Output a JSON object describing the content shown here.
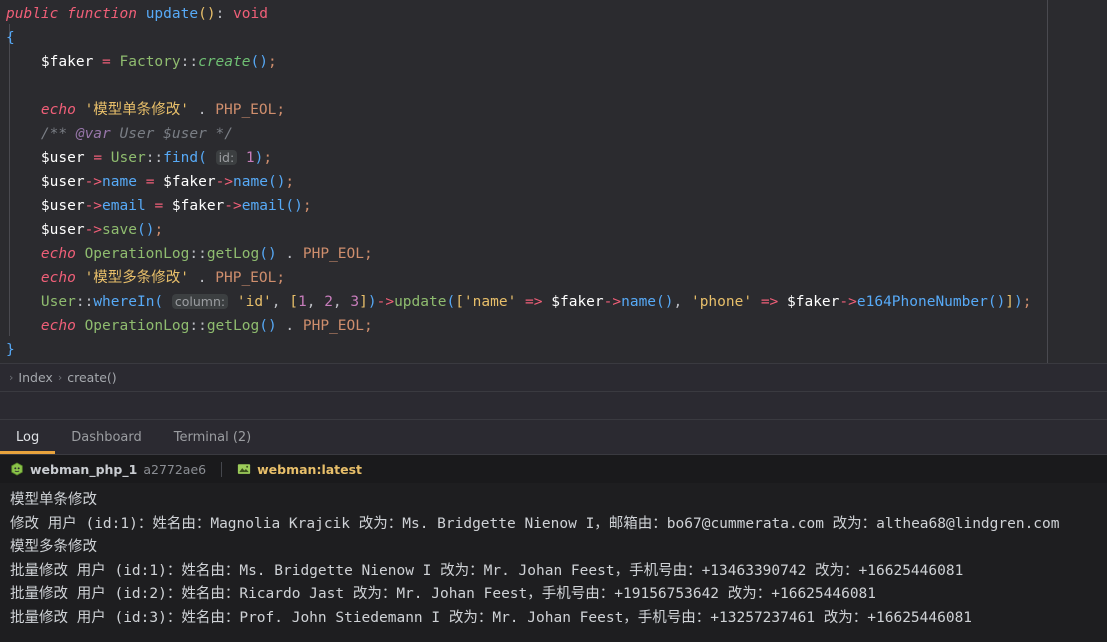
{
  "editor": {
    "name": "php-code-editor",
    "lines": [
      [
        {
          "t": "public",
          "c": "t-kw2"
        },
        {
          "t": " ",
          "c": "t-punct"
        },
        {
          "t": "function",
          "c": "t-kw2"
        },
        {
          "t": " ",
          "c": "t-punct"
        },
        {
          "t": "update",
          "c": "t-method"
        },
        {
          "t": "(",
          "c": "t-paren2"
        },
        {
          "t": ")",
          "c": "t-paren2"
        },
        {
          "t": ":",
          "c": "t-punct"
        },
        {
          "t": " ",
          "c": "t-punct"
        },
        {
          "t": "void",
          "c": "t-void"
        }
      ],
      [
        {
          "t": "{",
          "c": "t-brace"
        }
      ],
      [
        {
          "t": "    ",
          "c": "t-punct"
        },
        {
          "t": "$faker",
          "c": "t-var"
        },
        {
          "t": " ",
          "c": "t-punct"
        },
        {
          "t": "=",
          "c": "t-op"
        },
        {
          "t": " ",
          "c": "t-punct"
        },
        {
          "t": "Factory",
          "c": "t-class"
        },
        {
          "t": "::",
          "c": "t-punct"
        },
        {
          "t": "create",
          "c": "t-methodi"
        },
        {
          "t": "(",
          "c": "t-paren"
        },
        {
          "t": ")",
          "c": "t-paren"
        },
        {
          "t": ";",
          "c": "t-semi"
        }
      ],
      [],
      [
        {
          "t": "    ",
          "c": "t-punct"
        },
        {
          "t": "echo",
          "c": "t-echo"
        },
        {
          "t": " ",
          "c": "t-punct"
        },
        {
          "t": "'模型单条修改'",
          "c": "t-str"
        },
        {
          "t": " ",
          "c": "t-punct"
        },
        {
          "t": ".",
          "c": "t-punct"
        },
        {
          "t": " ",
          "c": "t-punct"
        },
        {
          "t": "PHP_EOL",
          "c": "t-const"
        },
        {
          "t": ";",
          "c": "t-semi"
        }
      ],
      [
        {
          "t": "    ",
          "c": "t-punct"
        },
        {
          "t": "/** ",
          "c": "t-comment"
        },
        {
          "t": "@var",
          "c": "t-tag"
        },
        {
          "t": " User $user */",
          "c": "t-comment"
        }
      ],
      [
        {
          "t": "    ",
          "c": "t-punct"
        },
        {
          "t": "$user",
          "c": "t-var"
        },
        {
          "t": " ",
          "c": "t-punct"
        },
        {
          "t": "=",
          "c": "t-op"
        },
        {
          "t": " ",
          "c": "t-punct"
        },
        {
          "t": "User",
          "c": "t-class"
        },
        {
          "t": "::",
          "c": "t-punct"
        },
        {
          "t": "find",
          "c": "t-method"
        },
        {
          "t": "(",
          "c": "t-paren"
        },
        {
          "t": " ",
          "c": "t-punct"
        },
        {
          "t": "id:",
          "c": "hint"
        },
        {
          "t": " ",
          "c": "t-punct"
        },
        {
          "t": "1",
          "c": "t-num"
        },
        {
          "t": ")",
          "c": "t-paren"
        },
        {
          "t": ";",
          "c": "t-semi"
        }
      ],
      [
        {
          "t": "    ",
          "c": "t-punct"
        },
        {
          "t": "$user",
          "c": "t-var"
        },
        {
          "t": "->",
          "c": "t-arrow"
        },
        {
          "t": "name",
          "c": "t-method"
        },
        {
          "t": " ",
          "c": "t-punct"
        },
        {
          "t": "=",
          "c": "t-op"
        },
        {
          "t": " ",
          "c": "t-punct"
        },
        {
          "t": "$faker",
          "c": "t-var"
        },
        {
          "t": "->",
          "c": "t-arrow"
        },
        {
          "t": "name",
          "c": "t-method"
        },
        {
          "t": "(",
          "c": "t-paren"
        },
        {
          "t": ")",
          "c": "t-paren"
        },
        {
          "t": ";",
          "c": "t-semi"
        }
      ],
      [
        {
          "t": "    ",
          "c": "t-punct"
        },
        {
          "t": "$user",
          "c": "t-var"
        },
        {
          "t": "->",
          "c": "t-arrow"
        },
        {
          "t": "email",
          "c": "t-method"
        },
        {
          "t": " ",
          "c": "t-punct"
        },
        {
          "t": "=",
          "c": "t-op"
        },
        {
          "t": " ",
          "c": "t-punct"
        },
        {
          "t": "$faker",
          "c": "t-var"
        },
        {
          "t": "->",
          "c": "t-arrow"
        },
        {
          "t": "email",
          "c": "t-method"
        },
        {
          "t": "(",
          "c": "t-paren"
        },
        {
          "t": ")",
          "c": "t-paren"
        },
        {
          "t": ";",
          "c": "t-semi"
        }
      ],
      [
        {
          "t": "    ",
          "c": "t-punct"
        },
        {
          "t": "$user",
          "c": "t-var"
        },
        {
          "t": "->",
          "c": "t-arrow"
        },
        {
          "t": "save",
          "c": "t-class"
        },
        {
          "t": "(",
          "c": "t-paren"
        },
        {
          "t": ")",
          "c": "t-paren"
        },
        {
          "t": ";",
          "c": "t-semi"
        }
      ],
      [
        {
          "t": "    ",
          "c": "t-punct"
        },
        {
          "t": "echo",
          "c": "t-echo"
        },
        {
          "t": " ",
          "c": "t-punct"
        },
        {
          "t": "OperationLog",
          "c": "t-class"
        },
        {
          "t": "::",
          "c": "t-punct"
        },
        {
          "t": "getLog",
          "c": "t-class"
        },
        {
          "t": "(",
          "c": "t-paren"
        },
        {
          "t": ")",
          "c": "t-paren"
        },
        {
          "t": " ",
          "c": "t-punct"
        },
        {
          "t": ".",
          "c": "t-punct"
        },
        {
          "t": " ",
          "c": "t-punct"
        },
        {
          "t": "PHP_EOL",
          "c": "t-const"
        },
        {
          "t": ";",
          "c": "t-semi"
        }
      ],
      [
        {
          "t": "    ",
          "c": "t-punct"
        },
        {
          "t": "echo",
          "c": "t-echo"
        },
        {
          "t": " ",
          "c": "t-punct"
        },
        {
          "t": "'模型多条修改'",
          "c": "t-str"
        },
        {
          "t": " ",
          "c": "t-punct"
        },
        {
          "t": ".",
          "c": "t-punct"
        },
        {
          "t": " ",
          "c": "t-punct"
        },
        {
          "t": "PHP_EOL",
          "c": "t-const"
        },
        {
          "t": ";",
          "c": "t-semi"
        }
      ],
      [
        {
          "t": "    ",
          "c": "t-punct"
        },
        {
          "t": "User",
          "c": "t-class"
        },
        {
          "t": "::",
          "c": "t-punct"
        },
        {
          "t": "whereIn",
          "c": "t-method"
        },
        {
          "t": "(",
          "c": "t-paren"
        },
        {
          "t": " ",
          "c": "t-punct"
        },
        {
          "t": "column:",
          "c": "hint"
        },
        {
          "t": " ",
          "c": "t-punct"
        },
        {
          "t": "'id'",
          "c": "t-str"
        },
        {
          "t": ",",
          "c": "t-punct"
        },
        {
          "t": " ",
          "c": "t-punct"
        },
        {
          "t": "[",
          "c": "t-bracket"
        },
        {
          "t": "1",
          "c": "t-num"
        },
        {
          "t": ",",
          "c": "t-punct"
        },
        {
          "t": " ",
          "c": "t-punct"
        },
        {
          "t": "2",
          "c": "t-num"
        },
        {
          "t": ",",
          "c": "t-punct"
        },
        {
          "t": " ",
          "c": "t-punct"
        },
        {
          "t": "3",
          "c": "t-num"
        },
        {
          "t": "]",
          "c": "t-bracket"
        },
        {
          "t": ")",
          "c": "t-paren"
        },
        {
          "t": "->",
          "c": "t-arrow"
        },
        {
          "t": "update",
          "c": "t-class"
        },
        {
          "t": "(",
          "c": "t-paren"
        },
        {
          "t": "[",
          "c": "t-bracket"
        },
        {
          "t": "'name'",
          "c": "t-str"
        },
        {
          "t": " ",
          "c": "t-punct"
        },
        {
          "t": "=>",
          "c": "t-op"
        },
        {
          "t": " ",
          "c": "t-punct"
        },
        {
          "t": "$faker",
          "c": "t-var"
        },
        {
          "t": "->",
          "c": "t-arrow"
        },
        {
          "t": "name",
          "c": "t-method"
        },
        {
          "t": "(",
          "c": "t-paren"
        },
        {
          "t": ")",
          "c": "t-paren"
        },
        {
          "t": ",",
          "c": "t-punct"
        },
        {
          "t": " ",
          "c": "t-punct"
        },
        {
          "t": "'phone'",
          "c": "t-str"
        },
        {
          "t": " ",
          "c": "t-punct"
        },
        {
          "t": "=>",
          "c": "t-op"
        },
        {
          "t": " ",
          "c": "t-punct"
        },
        {
          "t": "$faker",
          "c": "t-var"
        },
        {
          "t": "->",
          "c": "t-arrow"
        },
        {
          "t": "e164PhoneNumber",
          "c": "t-method"
        },
        {
          "t": "(",
          "c": "t-paren"
        },
        {
          "t": ")",
          "c": "t-paren"
        },
        {
          "t": "]",
          "c": "t-bracket"
        },
        {
          "t": ")",
          "c": "t-paren"
        },
        {
          "t": ";",
          "c": "t-semi"
        }
      ],
      [
        {
          "t": "    ",
          "c": "t-punct"
        },
        {
          "t": "echo",
          "c": "t-echo"
        },
        {
          "t": " ",
          "c": "t-punct"
        },
        {
          "t": "OperationLog",
          "c": "t-class"
        },
        {
          "t": "::",
          "c": "t-punct"
        },
        {
          "t": "getLog",
          "c": "t-class"
        },
        {
          "t": "(",
          "c": "t-paren"
        },
        {
          "t": ")",
          "c": "t-paren"
        },
        {
          "t": " ",
          "c": "t-punct"
        },
        {
          "t": ".",
          "c": "t-punct"
        },
        {
          "t": " ",
          "c": "t-punct"
        },
        {
          "t": "PHP_EOL",
          "c": "t-const"
        },
        {
          "t": ";",
          "c": "t-semi"
        }
      ],
      [
        {
          "t": "}",
          "c": "t-brace"
        }
      ]
    ]
  },
  "breadcrumb": {
    "separator": "›",
    "items": [
      "Index",
      "create()"
    ]
  },
  "tabs": {
    "items": [
      {
        "label": "Log",
        "active": true
      },
      {
        "label": "Dashboard",
        "active": false
      },
      {
        "label": "Terminal (2)",
        "active": false
      }
    ],
    "active_underline_color": "#e8a33d"
  },
  "container_bar": {
    "container_icon": "docker-container-icon",
    "container_name": "webman_php_1",
    "container_hash": "a2772ae6",
    "image_icon": "docker-image-icon",
    "image_name": "webman:latest"
  },
  "console": {
    "lines": [
      "模型单条修改",
      "修改 用户 (id:1)：姓名由：Magnolia Krajcik 改为：Ms. Bridgette Nienow I，邮箱由：bo67@cummerata.com 改为：althea68@lindgren.com",
      "模型多条修改",
      "批量修改 用户 (id:1)：姓名由：Ms. Bridgette Nienow I 改为：Mr. Johan Feest，手机号由：+13463390742 改为：+16625446081",
      "批量修改 用户 (id:2)：姓名由：Ricardo Jast 改为：Mr. Johan Feest，手机号由：+19156753642 改为：+16625446081",
      "批量修改 用户 (id:3)：姓名由：Prof. John Stiedemann I 改为：Mr. Johan Feest，手机号由：+13257237461 改为：+16625446081"
    ]
  }
}
